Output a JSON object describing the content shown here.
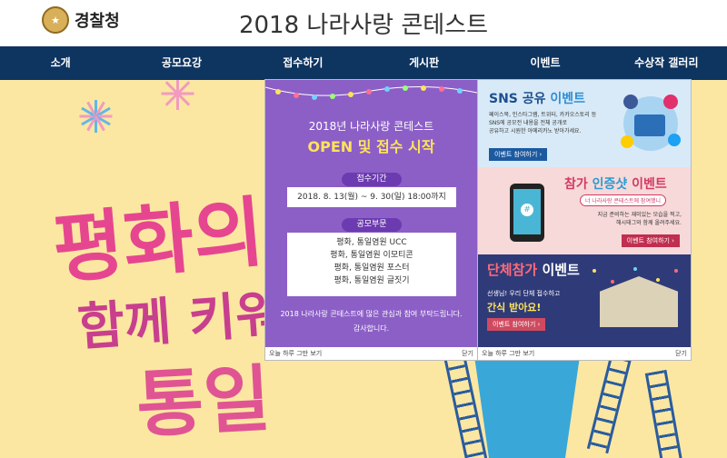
{
  "header": {
    "logo_text": "경찰청",
    "title": "2018 나라사랑 콘테스트"
  },
  "nav": {
    "items": [
      "소개",
      "공모요강",
      "접수하기",
      "게시판",
      "이벤트",
      "수상작 갤러리"
    ]
  },
  "hero": {
    "line1": "평화의",
    "line2": "함께 키워",
    "line3": "통일"
  },
  "popup_main": {
    "subtitle": "2018년 나라사랑 콘테스트",
    "title": "OPEN 및 접수 시작",
    "period_label": "접수기간",
    "period_value": "2018. 8. 13(월) ~ 9. 30(일) 18:00까지",
    "category_label": "공모부문",
    "categories": [
      "평화, 통일염원 UCC",
      "평화, 통일염원 이모티콘",
      "평화, 통일염원 포스터",
      "평화, 통일염원 글짓기"
    ],
    "note_line1": "2018 나라사랑 콘테스트에 많은 관심과 참여 부탁드립니다.",
    "note_line2": "감사합니다.",
    "footer_left": "오늘 하루 그만 보기",
    "footer_right": "닫기"
  },
  "popup_events": {
    "sns": {
      "title_a": "SNS 공유 ",
      "title_b": "이벤트",
      "desc_line1": "페이스북, 인스타그램, 트위터, 카카오스토리 등",
      "desc_line2": "SNS에 공모전 내용을 전체 공개로",
      "desc_line3": "공유하고 시원한 아메리카노 받아가세요.",
      "button": "이벤트 참여하기  ›"
    },
    "proof": {
      "title_a": "참가 ",
      "title_b": "인증샷",
      "title_c": " 이벤트",
      "bubble": "너 나라사랑 콘테스트에 참여했니",
      "desc_line1": "지금 준비하는 재미있는 모습을 찍고,",
      "desc_line2": "해시태그와 함께 올려주세요.",
      "button": "이벤트 참여하기  ›",
      "icon_text": "#"
    },
    "group": {
      "title_a": "단체참가 ",
      "title_b": "이벤트",
      "desc_line1": "선생님! 우리 단체 접수하고",
      "desc_line2": "간식 받아요!",
      "button": "이벤트 참여하기  ›"
    },
    "footer_left": "오늘 하루 그만 보기",
    "footer_right": "닫기"
  },
  "colors": {
    "nav_bg": "#0e3460",
    "hero_bg": "#fbe7a2",
    "popup_purple": "#8c5fc7",
    "highlight_yellow": "#ffe35a",
    "accent_pink": "#e6468f"
  }
}
